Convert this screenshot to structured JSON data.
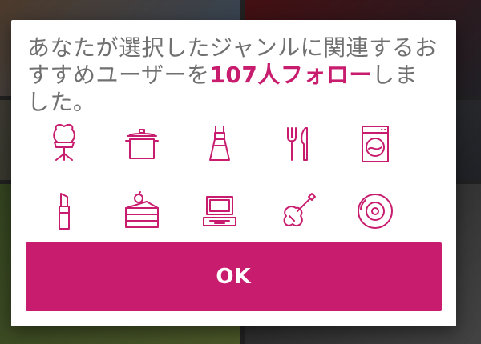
{
  "dialog": {
    "message_before": "あなたが選択したジャンルに関連するおすすめユーザーを",
    "message_highlight": "107人フォロー",
    "message_after": "しました。",
    "ok_label": "OK"
  },
  "genre_icons": [
    "chair-icon",
    "pot-icon",
    "dress-icon",
    "cutlery-icon",
    "washing-machine-icon",
    "lipstick-icon",
    "cake-icon",
    "laptop-icon",
    "guitar-icon",
    "cd-icon"
  ],
  "colors": {
    "accent": "#c81d6f",
    "message_text": "#707070",
    "dialog_bg": "#ffffff"
  }
}
